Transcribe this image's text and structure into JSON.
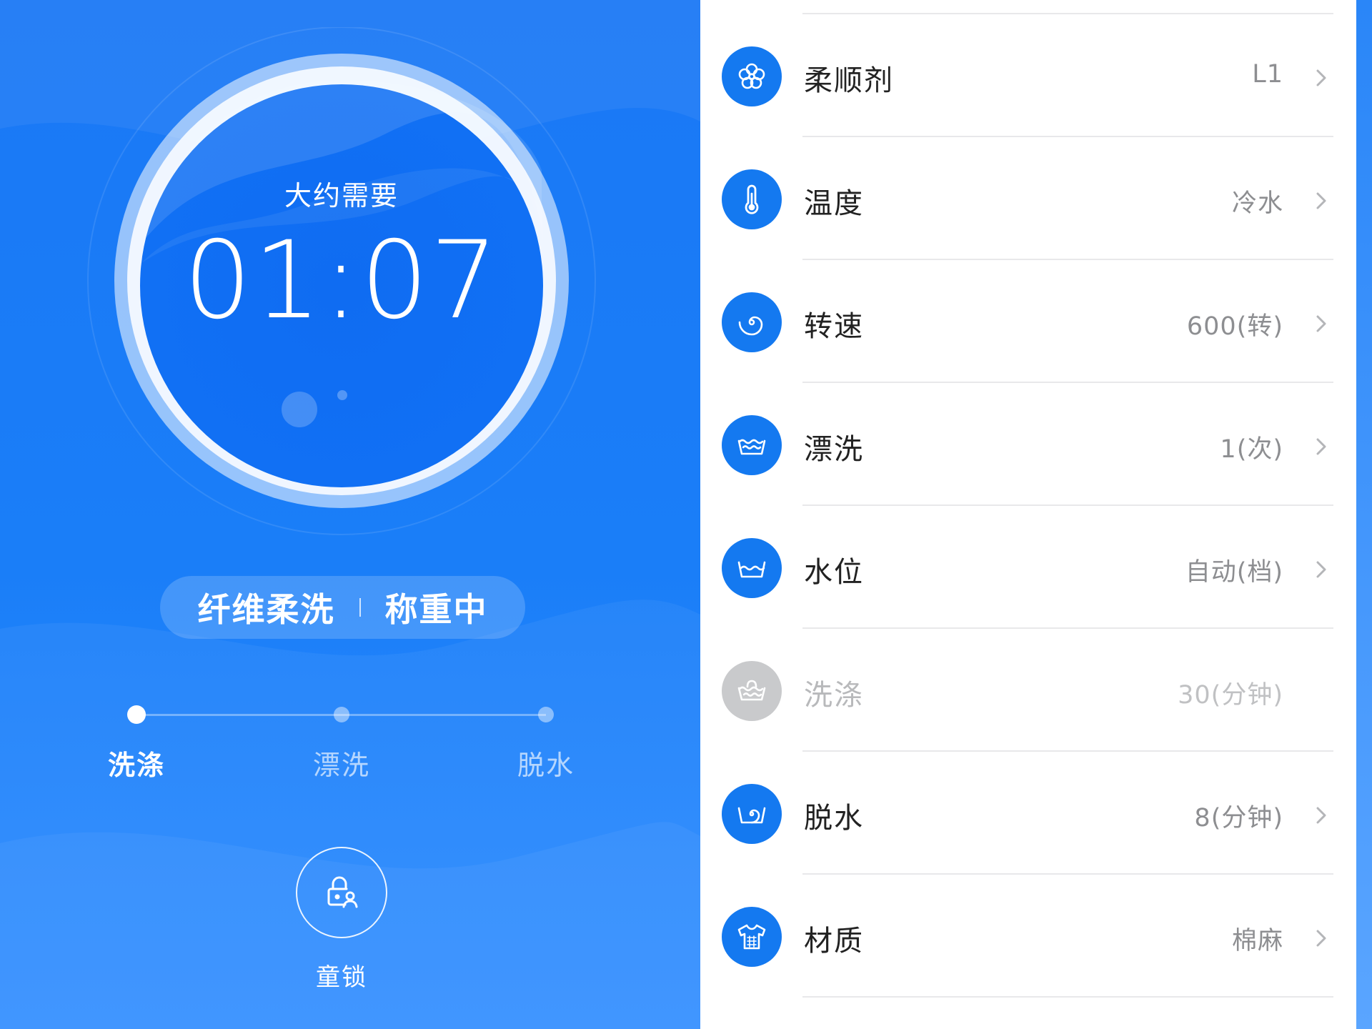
{
  "colors": {
    "panel_blue": "#1a78f5",
    "icon_blue": "#1479f0",
    "icon_disabled": "#c9cacc",
    "value_gray": "#8d8e91"
  },
  "dial": {
    "caption": "大约需要",
    "time": "01:07"
  },
  "status": {
    "program": "纤维柔洗",
    "state": "称重中"
  },
  "progress": {
    "steps": [
      {
        "label": "洗涤",
        "active": true
      },
      {
        "label": "漂洗",
        "active": false
      },
      {
        "label": "脱水",
        "active": false
      }
    ]
  },
  "child_lock": {
    "label": "童锁",
    "icon": "child-lock-icon"
  },
  "settings": [
    {
      "label": "柔顺剂",
      "value": "L1",
      "icon": "flower-icon",
      "enabled": true
    },
    {
      "label": "温度",
      "value": "冷水",
      "icon": "thermometer-icon",
      "enabled": true
    },
    {
      "label": "转速",
      "value": "600(转)",
      "icon": "spiral-icon",
      "enabled": true
    },
    {
      "label": "漂洗",
      "value": "1(次)",
      "icon": "rinse-tub-icon",
      "enabled": true
    },
    {
      "label": "水位",
      "value": "自动(档)",
      "icon": "water-level-icon",
      "enabled": true
    },
    {
      "label": "洗涤",
      "value": "30(分钟)",
      "icon": "wash-tub-icon",
      "enabled": false
    },
    {
      "label": "脱水",
      "value": "8(分钟)",
      "icon": "spin-dry-icon",
      "enabled": true
    },
    {
      "label": "材质",
      "value": "棉麻",
      "icon": "shirt-icon",
      "enabled": true
    }
  ]
}
